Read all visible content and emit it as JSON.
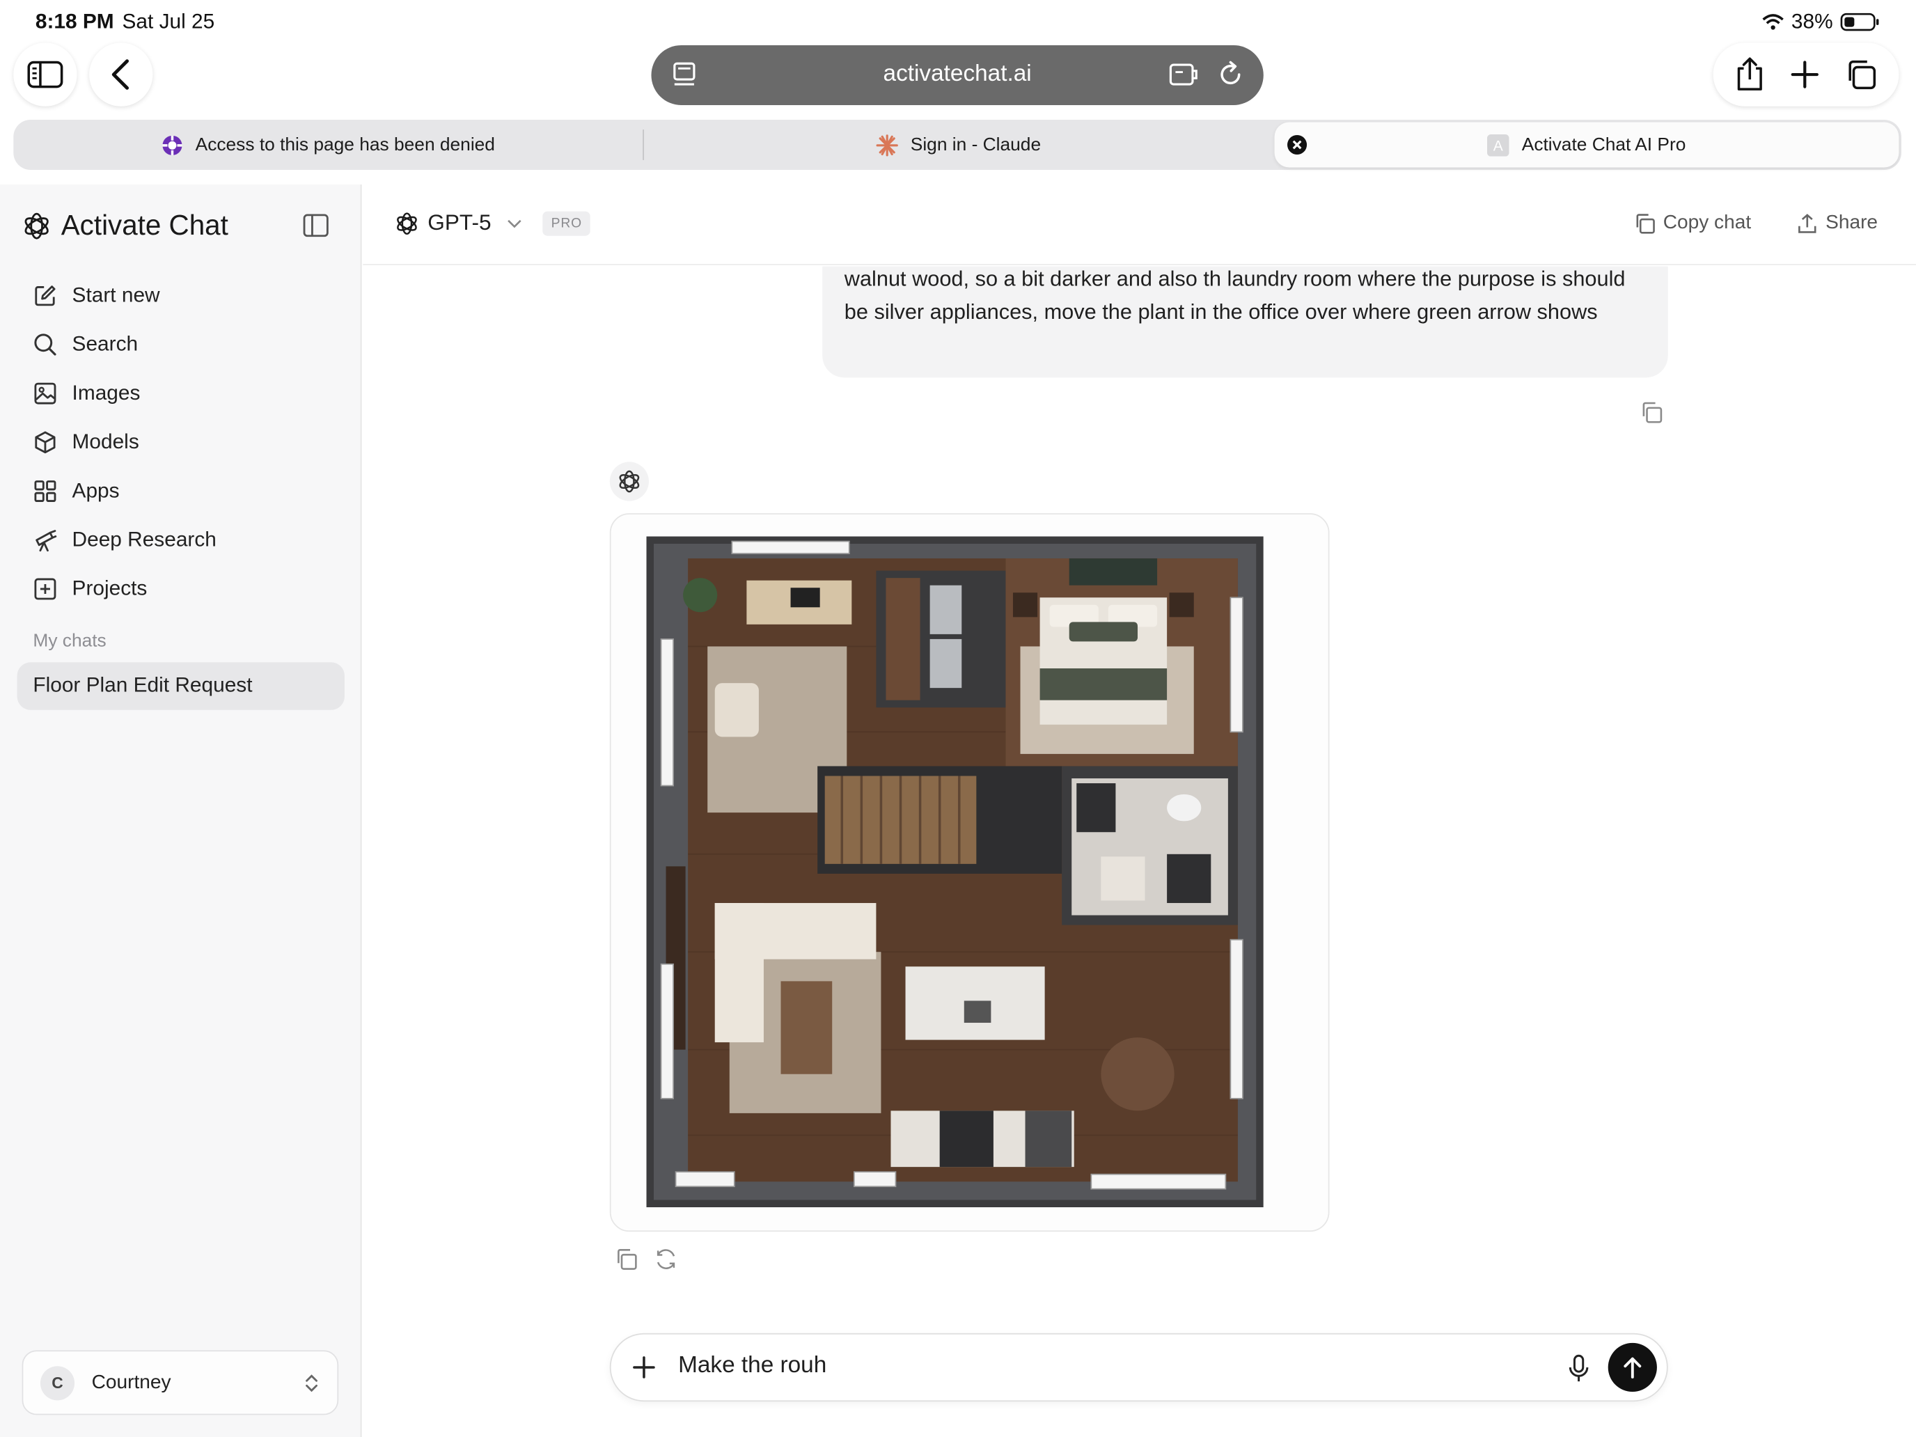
{
  "status_bar": {
    "time": "8:18 PM",
    "date": "Sat Jul 25",
    "battery": "38%"
  },
  "browser": {
    "address": "activatechat.ai",
    "tabs": [
      {
        "label": "Access to this page has been denied"
      },
      {
        "label": "Sign in - Claude"
      },
      {
        "label": "Activate Chat AI Pro"
      }
    ]
  },
  "sidebar": {
    "brand": "Activate Chat",
    "items": [
      {
        "label": "Start new",
        "icon": "edit-icon"
      },
      {
        "label": "Search",
        "icon": "search-icon"
      },
      {
        "label": "Images",
        "icon": "image-icon"
      },
      {
        "label": "Models",
        "icon": "cube-icon"
      },
      {
        "label": "Apps",
        "icon": "grid-icon"
      },
      {
        "label": "Deep Research",
        "icon": "telescope-icon"
      },
      {
        "label": "Projects",
        "icon": "plus-square-icon"
      }
    ],
    "section_label": "My chats",
    "chats": [
      {
        "label": "Floor Plan Edit Request"
      }
    ],
    "user": {
      "initial": "C",
      "name": "Courtney"
    }
  },
  "header": {
    "model": "GPT-5",
    "badge": "PRO",
    "copy_label": "Copy chat",
    "share_label": "Share"
  },
  "chat": {
    "user_message": "walnut wood, so a bit darker and also th laundry room where the purpose is should be silver appliances, move the plant in the office over where green arrow shows"
  },
  "composer": {
    "value": "Make the rouh"
  },
  "colors": {
    "accent": "#111111",
    "address_bar": "#6a6a6a",
    "sidebar_bg": "#f7f7f8",
    "floor_wood": "#5a3d2b",
    "wall": "#3c3c3e"
  }
}
